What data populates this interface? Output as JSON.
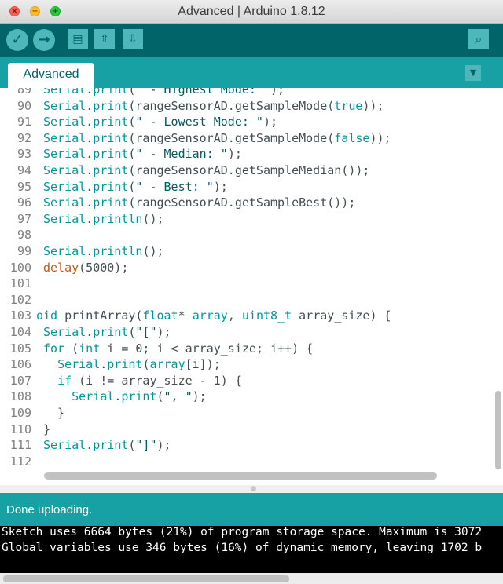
{
  "window": {
    "title": "Advanced | Arduino 1.8.12",
    "controls": {
      "close": "×",
      "minimize": "−",
      "maximize": "+"
    }
  },
  "toolbar": {
    "verify_icon": "✓",
    "upload_icon": "→",
    "new_icon": "▤",
    "open_icon": "⇧",
    "save_icon": "⇩",
    "serial_monitor_icon": "⌕"
  },
  "tabs": {
    "active": "Advanced",
    "menu_icon": "▼"
  },
  "editor": {
    "lines": [
      {
        "num": "89",
        "html": "<span class=\"ty\">Serial</span>.<span class=\"kw\">print</span>(<span class=\"st\">\" - Highest Mode: \"</span>);"
      },
      {
        "num": "90",
        "html": "<span class=\"ty\">Serial</span>.<span class=\"kw\">print</span>(rangeSensorAD.getSampleMode(<span class=\"kw\">true</span>));"
      },
      {
        "num": "91",
        "html": "<span class=\"ty\">Serial</span>.<span class=\"kw\">print</span>(<span class=\"st\">\" - Lowest Mode: \"</span>);"
      },
      {
        "num": "92",
        "html": "<span class=\"ty\">Serial</span>.<span class=\"kw\">print</span>(rangeSensorAD.getSampleMode(<span class=\"kw\">false</span>));"
      },
      {
        "num": "93",
        "html": "<span class=\"ty\">Serial</span>.<span class=\"kw\">print</span>(<span class=\"st\">\" - Median: \"</span>);"
      },
      {
        "num": "94",
        "html": "<span class=\"ty\">Serial</span>.<span class=\"kw\">print</span>(rangeSensorAD.getSampleMedian());"
      },
      {
        "num": "95",
        "html": "<span class=\"ty\">Serial</span>.<span class=\"kw\">print</span>(<span class=\"st\">\" - Best: \"</span>);"
      },
      {
        "num": "96",
        "html": "<span class=\"ty\">Serial</span>.<span class=\"kw\">print</span>(rangeSensorAD.getSampleBest());"
      },
      {
        "num": "97",
        "html": "<span class=\"ty\">Serial</span>.<span class=\"kw\">println</span>();"
      },
      {
        "num": "98",
        "html": ""
      },
      {
        "num": "99",
        "html": "<span class=\"ty\">Serial</span>.<span class=\"kw\">println</span>();"
      },
      {
        "num": "100",
        "html": "<span class=\"hl\">delay</span>(5000);"
      },
      {
        "num": "101",
        "html": ""
      },
      {
        "num": "102",
        "html": ""
      },
      {
        "num": "103",
        "html": "<span class=\"ty\">oid</span> printArray(<span class=\"ty\">float</span>* <span class=\"kw\">array</span>, <span class=\"ty\">uint8_t</span> array_size) {",
        "outdent": true
      },
      {
        "num": "104",
        "html": "<span class=\"ty\">Serial</span>.<span class=\"kw\">print</span>(<span class=\"st\">\"[\"</span>);"
      },
      {
        "num": "105",
        "html": "<span class=\"ty\">for</span> (<span class=\"ty\">int</span> i = 0; i &lt; array_size; i++) {"
      },
      {
        "num": "106",
        "html": "  <span class=\"ty\">Serial</span>.<span class=\"kw\">print</span>(<span class=\"kw\">array</span>[i]);"
      },
      {
        "num": "107",
        "html": "  <span class=\"ty\">if</span> (i != array_size - 1) {"
      },
      {
        "num": "108",
        "html": "    <span class=\"ty\">Serial</span>.<span class=\"kw\">print</span>(<span class=\"st\">\", \"</span>);"
      },
      {
        "num": "109",
        "html": "  }"
      },
      {
        "num": "110",
        "html": "}"
      },
      {
        "num": "111",
        "html": "<span class=\"ty\">Serial</span>.<span class=\"kw\">print</span>(<span class=\"st\">\"]\"</span>);"
      },
      {
        "num": "112",
        "html": ""
      }
    ]
  },
  "status": {
    "message": "Done uploading."
  },
  "console": {
    "lines": [
      "Sketch uses 6664 bytes (21%) of program storage space. Maximum is 3072",
      "Global variables use 346 bytes (16%) of dynamic memory, leaving 1702 b"
    ]
  },
  "colors": {
    "toolbar_bg": "#006468",
    "tabbar_bg": "#17a1a5",
    "button_bg": "#4db7bb",
    "keyword": "#00979c",
    "function_highlight": "#d35400"
  }
}
